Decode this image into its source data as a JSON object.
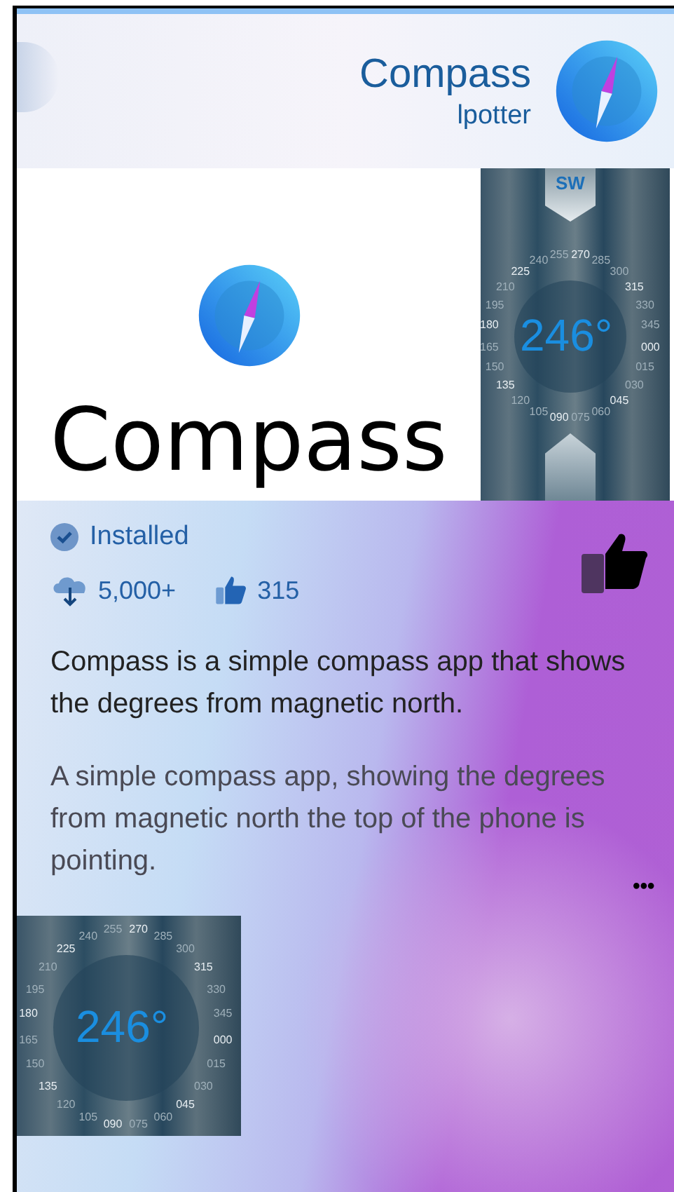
{
  "header": {
    "title": "Compass",
    "author": "lpotter"
  },
  "banner": {
    "title": "Compass"
  },
  "status": {
    "label": "Installed",
    "installed": true
  },
  "stats": {
    "downloads": "5,000+",
    "likes": "315"
  },
  "description": [
    "Compass is a simple compass app that shows the degrees from magnetic north.",
    "A simple compass app, showing the degrees from magnetic north the top of the phone is pointing."
  ],
  "more": "•••",
  "screenshots": [
    {
      "heading": "SW",
      "reading": "246°",
      "dial_labels": [
        "240",
        "255",
        "270",
        "285",
        "225",
        "300",
        "210",
        "315",
        "195",
        "330",
        "180",
        "345",
        "165",
        "000",
        "150",
        "015",
        "135",
        "030",
        "120",
        "045",
        "105",
        "090",
        "075",
        "060"
      ]
    },
    {
      "reading": "246°",
      "dial_labels": [
        "240",
        "255",
        "270",
        "285",
        "225",
        "300",
        "210",
        "315",
        "195",
        "330",
        "180",
        "345",
        "165",
        "000",
        "150",
        "015",
        "135",
        "030",
        "120",
        "045",
        "105",
        "090",
        "075",
        "060"
      ]
    }
  ]
}
